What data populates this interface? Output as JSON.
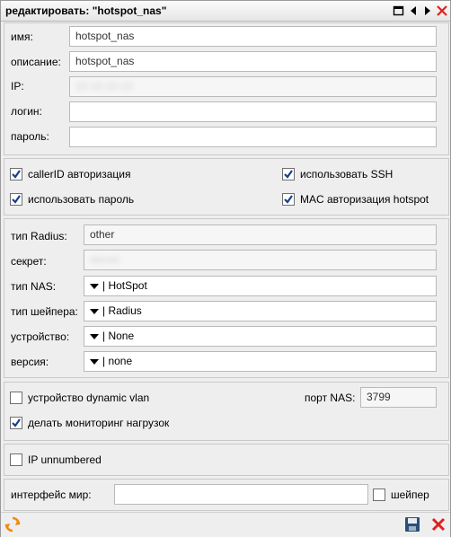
{
  "window": {
    "title": "редактировать: \"hotspot_nas\""
  },
  "main": {
    "name_label": "имя:",
    "name_value": "hotspot_nas",
    "desc_label": "описание:",
    "desc_value": "hotspot_nas",
    "ip_label": "IP:",
    "ip_value": "10.10.10.10",
    "login_label": "логин:",
    "login_value": "",
    "password_label": "пароль:",
    "password_value": ""
  },
  "options": {
    "callerid": {
      "label": "callerID авторизация",
      "checked": true
    },
    "ssh": {
      "label": "использовать SSH",
      "checked": true
    },
    "use_password": {
      "label": "использовать пароль",
      "checked": true
    },
    "mac_auth": {
      "label": "MAC авторизация hotspot",
      "checked": true
    }
  },
  "radius": {
    "type_label": "тип Radius:",
    "type_value": "other",
    "secret_label": "секрет:",
    "secret_value": "secret",
    "nas_type_label": "тип NAS:",
    "nas_type_value": "| HotSpot",
    "shaper_type_label": "тип шейпера:",
    "shaper_type_value": "| Radius",
    "device_label": "устройство:",
    "device_value": "| None",
    "version_label": "версия:",
    "version_value": "| none"
  },
  "dynamic": {
    "dynamic_vlan": {
      "label": "устройство dynamic vlan",
      "checked": false
    },
    "port_label": "порт NAS:",
    "port_value": "3799",
    "monitoring": {
      "label": "делать мониторинг нагрузок",
      "checked": true
    }
  },
  "unnumbered": {
    "label": "IP unnumbered",
    "checked": false
  },
  "world": {
    "iface_label": "интерфейс мир:",
    "iface_value": "",
    "shaper": {
      "label": "шейпер",
      "checked": false
    }
  },
  "colors": {
    "check": "#1a3f8f",
    "close": "#e02020",
    "refresh": "#f08a10",
    "save": "#2c4f7a"
  }
}
